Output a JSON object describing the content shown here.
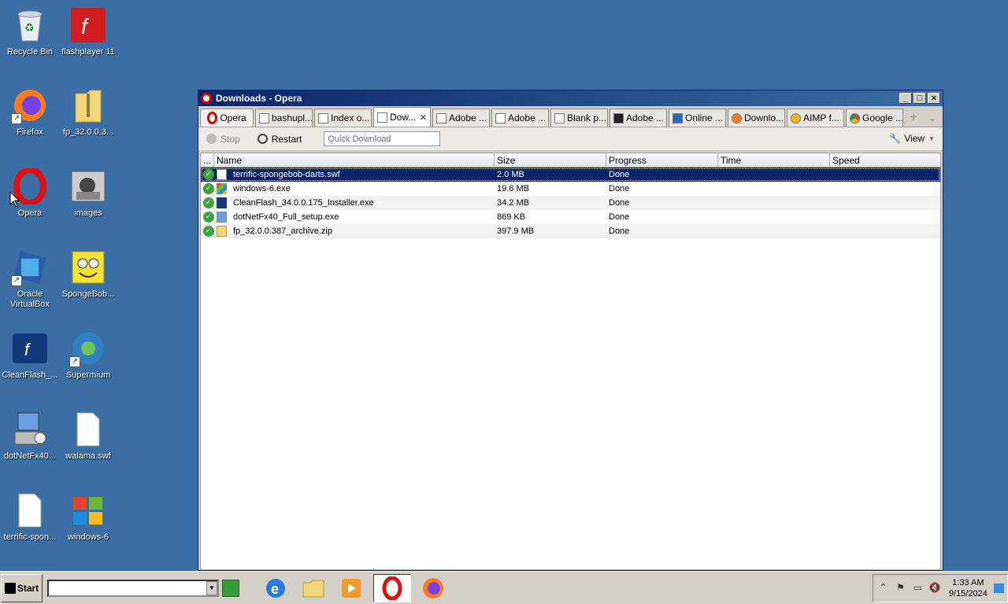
{
  "desktop": {
    "icons": [
      {
        "label": "Recycle Bin",
        "icon": "recycle-bin-icon"
      },
      {
        "label": "flashplayer 11",
        "icon": "flash-icon"
      },
      {
        "label": "Firefox",
        "icon": "firefox-icon"
      },
      {
        "label": "fp_32.0.0.3...",
        "icon": "zip-folder-icon"
      },
      {
        "label": "Opera",
        "icon": "opera-icon"
      },
      {
        "label": "images",
        "icon": "image-folder-icon"
      },
      {
        "label": "Oracle VirtualBox",
        "icon": "virtualbox-icon"
      },
      {
        "label": "SpongeBob...",
        "icon": "spongebob-icon"
      },
      {
        "label": "CleanFlash_...",
        "icon": "cleanflash-icon"
      },
      {
        "label": "Supermium",
        "icon": "supermium-icon"
      },
      {
        "label": "dotNetFx40...",
        "icon": "installer-icon"
      },
      {
        "label": "walama.swf",
        "icon": "file-icon"
      },
      {
        "label": "terrific-spon...",
        "icon": "file-icon"
      },
      {
        "label": "windows-6",
        "icon": "windows-icon"
      }
    ]
  },
  "window": {
    "title": "Downloads - Opera",
    "opera_button": "Opera",
    "tabs": [
      {
        "label": "bashupl...",
        "active": false
      },
      {
        "label": "Index o...",
        "active": false
      },
      {
        "label": "Dow...",
        "active": true
      },
      {
        "label": "Adobe ...",
        "active": false
      },
      {
        "label": "Adobe ...",
        "active": false
      },
      {
        "label": "Blank p...",
        "active": false
      },
      {
        "label": "Adobe ...",
        "active": false
      },
      {
        "label": "Online ...",
        "active": false
      },
      {
        "label": "Downlo...",
        "active": false
      },
      {
        "label": "AIMP f...",
        "active": false
      },
      {
        "label": "Google ...",
        "active": false
      }
    ],
    "toolbar": {
      "stop": "Stop",
      "restart": "Restart",
      "quick_download_placeholder": "Quick Download",
      "view": "View"
    },
    "columns": [
      "...",
      "Name",
      "Size",
      "Progress",
      "Time",
      "Speed"
    ],
    "downloads": [
      {
        "name": "terrific-spongebob-darts.swf",
        "size": "2.0 MB",
        "progress": "Done",
        "time": "",
        "speed": ""
      },
      {
        "name": "windows-6.exe",
        "size": "19.6 MB",
        "progress": "Done",
        "time": "",
        "speed": ""
      },
      {
        "name": "CleanFlash_34.0.0.175_Installer.exe",
        "size": "34.2 MB",
        "progress": "Done",
        "time": "",
        "speed": ""
      },
      {
        "name": "dotNetFx40_Full_setup.exe",
        "size": "869 KB",
        "progress": "Done",
        "time": "",
        "speed": ""
      },
      {
        "name": "fp_32.0.0.387_archive.zip",
        "size": "397.9 MB",
        "progress": "Done",
        "time": "",
        "speed": ""
      }
    ]
  },
  "taskbar": {
    "start": "Start",
    "clock_time": "1:33 AM",
    "clock_date": "9/15/2024"
  },
  "colors": {
    "desktop": "#3b6ea5",
    "selection": "#0a246a",
    "done_check": "#3ca33c",
    "opera_red": "#d00000"
  }
}
